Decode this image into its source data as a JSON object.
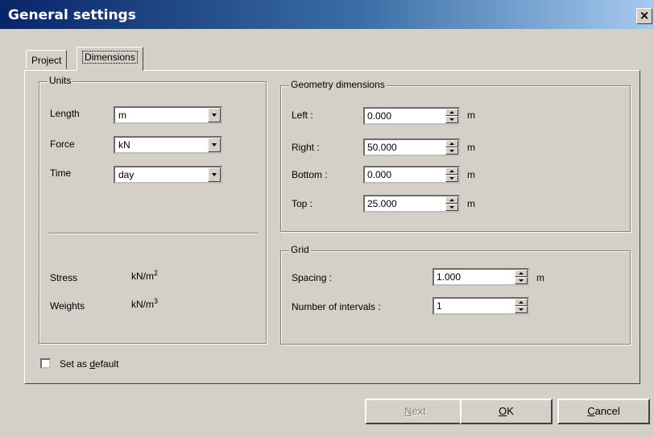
{
  "window": {
    "title": "General settings",
    "close_label": "×"
  },
  "tabs": [
    {
      "label": "Project",
      "active": false
    },
    {
      "label": "Dimensions",
      "active": true
    }
  ],
  "units": {
    "legend": "Units",
    "length": {
      "label": "Length",
      "value": "m"
    },
    "force": {
      "label": "Force",
      "value": "kN"
    },
    "time": {
      "label": "Time",
      "value": "day"
    },
    "stress": {
      "label": "Stress",
      "unit": "kN/m",
      "power": "2"
    },
    "weights": {
      "label": "Weights",
      "unit": "kN/m",
      "power": "3"
    }
  },
  "geometry": {
    "legend": "Geometry dimensions",
    "left": {
      "label": "Left :",
      "value": "0.000",
      "unit": "m"
    },
    "right": {
      "label": "Right :",
      "value": "50.000",
      "unit": "m"
    },
    "bottom": {
      "label": "Bottom :",
      "value": "0.000",
      "unit": "m"
    },
    "top": {
      "label": "Top :",
      "value": "25.000",
      "unit": "m"
    }
  },
  "grid": {
    "legend": "Grid",
    "spacing": {
      "label": "Spacing :",
      "value": "1.000",
      "unit": "m"
    },
    "intervals": {
      "label": "Number of intervals :",
      "value": "1"
    }
  },
  "default": {
    "label_pre": "Set as ",
    "label_ul": "d",
    "label_post": "efault",
    "checked": false
  },
  "buttons": {
    "next": {
      "ul": "N",
      "rest": "ext",
      "enabled": false
    },
    "ok": {
      "ul": "O",
      "rest": "K"
    },
    "cancel": {
      "ul": "C",
      "rest": "ancel"
    }
  }
}
